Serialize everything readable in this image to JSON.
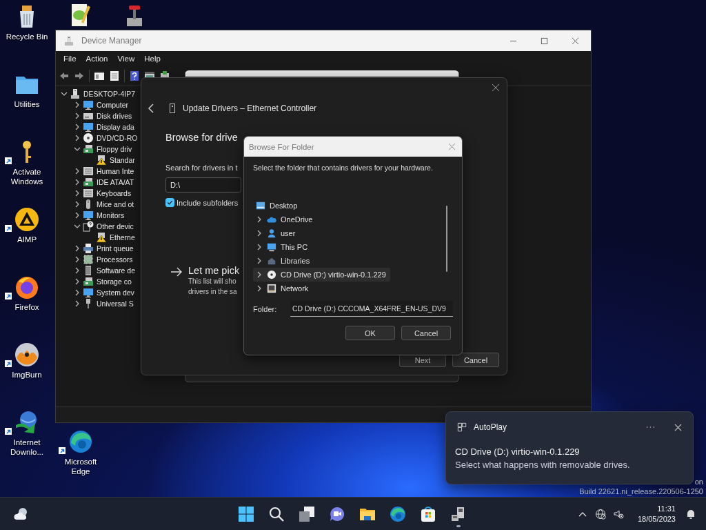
{
  "desktop_icons": [
    [
      {
        "kind": "recycle",
        "label": "Recycle Bin",
        "shortcut": false
      },
      {
        "kind": "folder",
        "label": "Utilities",
        "shortcut": false
      },
      {
        "kind": "key",
        "label": "Activate Windows",
        "shortcut": true
      },
      {
        "kind": "aimp",
        "label": "AIMP",
        "shortcut": true
      },
      {
        "kind": "firefox",
        "label": "Firefox",
        "shortcut": true
      },
      {
        "kind": "imgburn",
        "label": "ImgBurn",
        "shortcut": true
      },
      {
        "kind": "idm",
        "label": "Internet Downlo...",
        "shortcut": true
      }
    ],
    [
      {
        "kind": "notepad",
        "shortcut": false
      },
      {
        "kind": "edge",
        "label": "Microsoft Edge",
        "shortcut": true
      }
    ],
    [
      {
        "kind": "lever",
        "shortcut": false
      }
    ]
  ],
  "device_manager": {
    "title": "Device Manager",
    "menu": [
      "File",
      "Action",
      "View",
      "Help"
    ],
    "tree": {
      "kind": "root",
      "label": "DESKTOP-4IP7",
      "expanded": true,
      "children": [
        {
          "kind": "computer",
          "label": "Computer",
          "expanded": false
        },
        {
          "kind": "drive",
          "label": "Disk drives",
          "expanded": false
        },
        {
          "kind": "display",
          "label": "Display ada",
          "expanded": false
        },
        {
          "kind": "disc",
          "label": "DVD/CD-RO",
          "expanded": false
        },
        {
          "kind": "floppy",
          "label": "Floppy driv",
          "expanded": true,
          "children": [
            {
              "kind": "warning",
              "label": "Standar"
            }
          ]
        },
        {
          "kind": "hid",
          "label": "Human Inte",
          "expanded": false
        },
        {
          "kind": "ide",
          "label": "IDE ATA/AT",
          "expanded": false
        },
        {
          "kind": "keyboard",
          "label": "Keyboards",
          "expanded": false
        },
        {
          "kind": "mouse",
          "label": "Mice and ot",
          "expanded": false
        },
        {
          "kind": "monitor",
          "label": "Monitors",
          "expanded": false
        },
        {
          "kind": "other",
          "label": "Other devic",
          "expanded": true,
          "children": [
            {
              "kind": "warning",
              "label": "Etherne"
            }
          ]
        },
        {
          "kind": "printer",
          "label": "Print queue",
          "expanded": false
        },
        {
          "kind": "processor",
          "label": "Processors",
          "expanded": false
        },
        {
          "kind": "software",
          "label": "Software de",
          "expanded": false
        },
        {
          "kind": "storage",
          "label": "Storage co",
          "expanded": false
        },
        {
          "kind": "system",
          "label": "System dev",
          "expanded": false
        },
        {
          "kind": "usb",
          "label": "Universal S",
          "expanded": false
        }
      ]
    }
  },
  "update_drivers": {
    "title": "Update Drivers – Ethernet Controller",
    "heading": "Browse for drive",
    "search_label": "Search for drivers in t",
    "path_value": "D:\\",
    "include_subfolders": {
      "label": "Include subfolders",
      "checked": true
    },
    "pick": {
      "title": "Let me pick",
      "line_1": "This list will sho",
      "line_2": "drivers in the sa"
    },
    "buttons": [
      "Next",
      "Cancel"
    ]
  },
  "browse_folder": {
    "title": "Browse For Folder",
    "instruction": "Select the folder that contains drivers for your hardware.",
    "tree": {
      "kind": "desktop",
      "label": "Desktop",
      "children": [
        {
          "kind": "cloud",
          "label": "OneDrive",
          "expanded": false,
          "selected": false
        },
        {
          "kind": "user",
          "label": "user",
          "expanded": false,
          "selected": false
        },
        {
          "kind": "pc",
          "label": "This PC",
          "expanded": false,
          "selected": false
        },
        {
          "kind": "libraries",
          "label": "Libraries",
          "expanded": false,
          "selected": false
        },
        {
          "kind": "disc",
          "label": "CD Drive (D:) virtio-win-0.1.229",
          "expanded": false,
          "selected": true
        },
        {
          "kind": "network",
          "label": "Network",
          "expanded": false,
          "selected": false
        }
      ]
    },
    "folder_label": "Folder:",
    "folder_value": "CD Drive (D:) CCCOMA_X64FRE_EN-US_DV9",
    "buttons": [
      "OK",
      "Cancel"
    ]
  },
  "notification": {
    "app": "AutoPlay",
    "title": "CD Drive (D:) virtio-win-0.1.229",
    "body": "Select what happens with removable drives."
  },
  "watermark": {
    "line_1": "on",
    "line_2": "Build 22621.ni_release.220506-1250"
  },
  "taskbar": {
    "apps": [
      {
        "kind": "start",
        "running": false
      },
      {
        "kind": "search",
        "running": false
      },
      {
        "kind": "taskview",
        "running": false
      },
      {
        "kind": "chat",
        "running": false
      },
      {
        "kind": "explorer",
        "running": false
      },
      {
        "kind": "edge",
        "running": false
      },
      {
        "kind": "store",
        "running": false
      },
      {
        "kind": "devices",
        "running": true
      }
    ],
    "time": "11:31",
    "date": "18/05/2023"
  }
}
